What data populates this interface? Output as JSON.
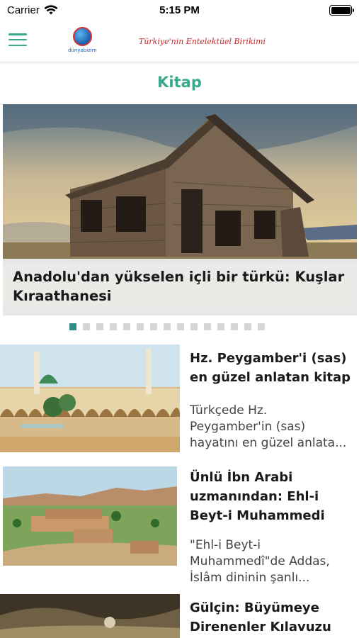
{
  "status_bar": {
    "carrier": "Carrier",
    "time": "5:15 PM",
    "wifi_icon": "wifi-icon",
    "battery_icon": "battery-icon",
    "battery_level": 1.0
  },
  "navbar": {
    "menu_icon": "hamburger-menu-icon",
    "logo_text": "dünyabizim",
    "tagline": "Türkiye'nin Entelektüel Birikimi",
    "accent_color": "#3aa88a"
  },
  "page": {
    "title": "Kitap"
  },
  "slider": {
    "caption": [
      "Anadolu'dan yükselen içli bir türkü: Kuşlar",
      "Kıraathanesi"
    ],
    "slide_count": 15,
    "active_index": 0,
    "active_color": "#2f8f86",
    "inactive_color": "#d6d6d6"
  },
  "articles": [
    {
      "title": [
        "Hz. Peygamber'i (sas)",
        "en güzel anlatan kitap"
      ],
      "summary": [
        "Türkçede Hz.",
        "Peygamber'in (sas)",
        "hayatını en güzel anlata..."
      ]
    },
    {
      "title": [
        "Ünlü İbn Arabi",
        "uzmanından: Ehl-i",
        "Beyt-i Muhammedi"
      ],
      "summary": [
        "\"Ehl-i Beyt-i",
        "Muhammedî\"de Addas,",
        "İslâm dininin şanlı..."
      ]
    },
    {
      "title": [
        "Gülçin: Büyümeye",
        "Direnenler Kılavuzu"
      ],
      "summary": []
    }
  ]
}
